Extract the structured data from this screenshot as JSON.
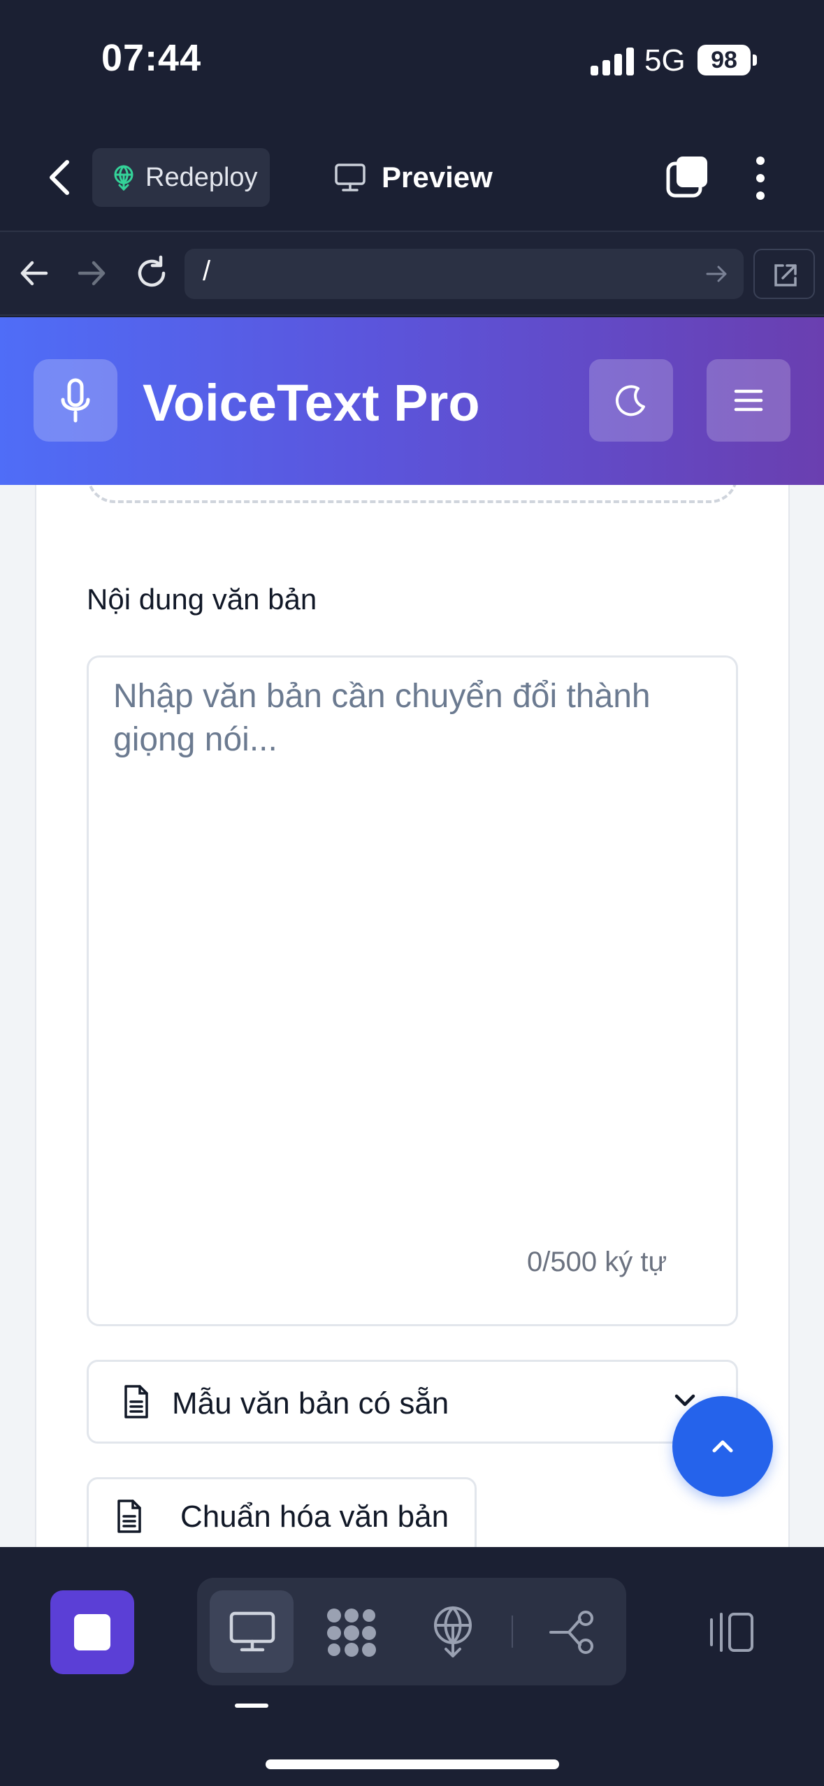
{
  "status_bar": {
    "time": "07:44",
    "network": "5G",
    "battery": "98"
  },
  "toolbar": {
    "redeploy_label": "Redeploy",
    "preview_label": "Preview"
  },
  "browser": {
    "url": "/"
  },
  "app": {
    "title": "VoiceText Pro"
  },
  "form": {
    "text_section_label": "Nội dung văn bản",
    "text_placeholder": "Nhập văn bản cần chuyển đổi thành giọng nói...",
    "char_counter": "0/500 ký tự",
    "template_select_label": "Mẫu văn bản có sẵn",
    "normalize_button_label": "Chuẩn hóa văn bản"
  },
  "colors": {
    "accent": "#2563eb",
    "header_start": "#4f6df7",
    "header_end": "#6a3fb0",
    "stop_button": "#5b3fd6"
  },
  "icons": [
    "chevron-left-icon",
    "globe-icon",
    "monitor-icon",
    "tabs-icon",
    "more-vertical-icon",
    "arrow-left-icon",
    "arrow-right-icon",
    "reload-icon",
    "external-link-icon",
    "microphone-icon",
    "moon-icon",
    "hamburger-menu-icon",
    "document-icon",
    "chevron-down-icon",
    "chevron-up-icon",
    "stop-icon",
    "dots-grid-icon",
    "flow-icon",
    "panel-icon"
  ]
}
